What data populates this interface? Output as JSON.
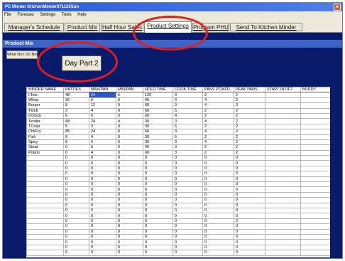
{
  "window": {
    "title": "PC Minder KitchenMinder071125Sun"
  },
  "menu": [
    "File",
    "Forecast",
    "Settings",
    "Tools",
    "Help"
  ],
  "tabs": [
    {
      "label": "Manager's Schedule"
    },
    {
      "label": "Product Mix"
    },
    {
      "label": "Half Hour Sales"
    },
    {
      "label": "Product Settings"
    },
    {
      "label": "Program PHU"
    },
    {
      "label": "Send To Kitchen Minder"
    }
  ],
  "active_tab": "Product Settings",
  "subheader": "Product Mix",
  "help_button": "What Do I Do Now",
  "daypart_button": "Day Part 2",
  "grid": {
    "columns": [
      "MINDER NAME",
      "PATTIES",
      "MAX/PAN",
      "MIN/PAN",
      "HOLD TIME",
      "COOK TIME",
      "PANS PCMFD",
      "PEAK PANS",
      "START IN DFT",
      "BUDDY"
    ],
    "rows": [
      [
        "LTots",
        "48",
        "24",
        "6",
        "120",
        "3",
        "2",
        "2",
        "",
        ""
      ],
      [
        "Whop",
        "36",
        "6",
        "0",
        "45",
        "3",
        "4",
        "2",
        "",
        ""
      ],
      [
        "Burger",
        "8",
        "12",
        "0",
        "60",
        "3",
        "4",
        "3",
        "",
        ""
      ],
      [
        "TGrill",
        "3",
        "4",
        "0",
        "60",
        "5",
        "2",
        "2",
        "",
        ""
      ],
      [
        "OChick",
        "6",
        "6",
        "0",
        "60",
        "4",
        "2",
        "2",
        "",
        ""
      ],
      [
        "Tender",
        "88",
        "24",
        "4",
        "30",
        "3",
        "4",
        "2",
        "",
        ""
      ],
      [
        "TCrisp",
        "5",
        "3",
        "0",
        "30",
        "6",
        "2",
        "2",
        "",
        ""
      ],
      [
        "ChkFry",
        "85",
        "24",
        "6",
        "60",
        "3",
        "4",
        "2",
        "",
        ""
      ],
      [
        "Fish",
        "8",
        "4",
        "0",
        "30",
        "5",
        "2",
        "2",
        "",
        ""
      ],
      [
        "Spicy",
        "8",
        "6",
        "0",
        "30",
        "3",
        "4",
        "2",
        "",
        ""
      ],
      [
        "Steak",
        "0",
        "6",
        "0",
        "45",
        "3",
        "2",
        "2",
        "",
        ""
      ],
      [
        "Potato",
        "0",
        "4",
        "0",
        "60",
        "3",
        "2",
        "2",
        "",
        ""
      ],
      [
        "",
        "0",
        "0",
        "0",
        "0",
        "0",
        "0",
        "0",
        "",
        ""
      ],
      [
        "",
        "0",
        "0",
        "0",
        "0",
        "0",
        "0",
        "0",
        "",
        ""
      ],
      [
        "",
        "0",
        "0",
        "0",
        "0",
        "0",
        "0",
        "0",
        "",
        ""
      ],
      [
        "",
        "0",
        "0",
        "0",
        "0",
        "0",
        "0",
        "0",
        "",
        ""
      ],
      [
        "",
        "0",
        "0",
        "0",
        "0",
        "0",
        "0",
        "0",
        "",
        ""
      ],
      [
        "",
        "0",
        "0",
        "0",
        "0",
        "0",
        "0",
        "0",
        "",
        ""
      ],
      [
        "",
        "0",
        "0",
        "0",
        "0",
        "0",
        "0",
        "0",
        "",
        ""
      ],
      [
        "",
        "0",
        "0",
        "0",
        "0",
        "0",
        "0",
        "0",
        "",
        ""
      ],
      [
        "",
        "0",
        "0",
        "0",
        "0",
        "0",
        "0",
        "0",
        "",
        ""
      ],
      [
        "",
        "0",
        "0",
        "0",
        "0",
        "0",
        "0",
        "0",
        "",
        ""
      ],
      [
        "",
        "0",
        "0",
        "0",
        "0",
        "0",
        "0",
        "0",
        "",
        ""
      ],
      [
        "",
        "0",
        "0",
        "0",
        "0",
        "0",
        "0",
        "0",
        "",
        ""
      ],
      [
        "",
        "0",
        "0",
        "0",
        "0",
        "0",
        "0",
        "0",
        "",
        ""
      ],
      [
        "",
        "0",
        "0",
        "0",
        "0",
        "0",
        "0",
        "0",
        "",
        ""
      ],
      [
        "",
        "0",
        "0",
        "0",
        "0",
        "0",
        "0",
        "0",
        "",
        ""
      ],
      [
        "",
        "0",
        "0",
        "0",
        "0",
        "0",
        "0",
        "0",
        "",
        ""
      ],
      [
        "",
        "0",
        "0",
        "0",
        "0",
        "0",
        "0",
        "0",
        "",
        ""
      ],
      [
        "",
        "0",
        "0",
        "0",
        "0",
        "0",
        "0",
        "0",
        "",
        ""
      ],
      [
        "",
        "0",
        "0",
        "0",
        "0",
        "0",
        "0",
        "0",
        "",
        ""
      ]
    ],
    "selected_cell": {
      "row": 0,
      "col": 2
    }
  },
  "colors": {
    "window_bg": "#0a1b6b",
    "annotation": "#e21d1d",
    "selection": "#2d57c9"
  }
}
